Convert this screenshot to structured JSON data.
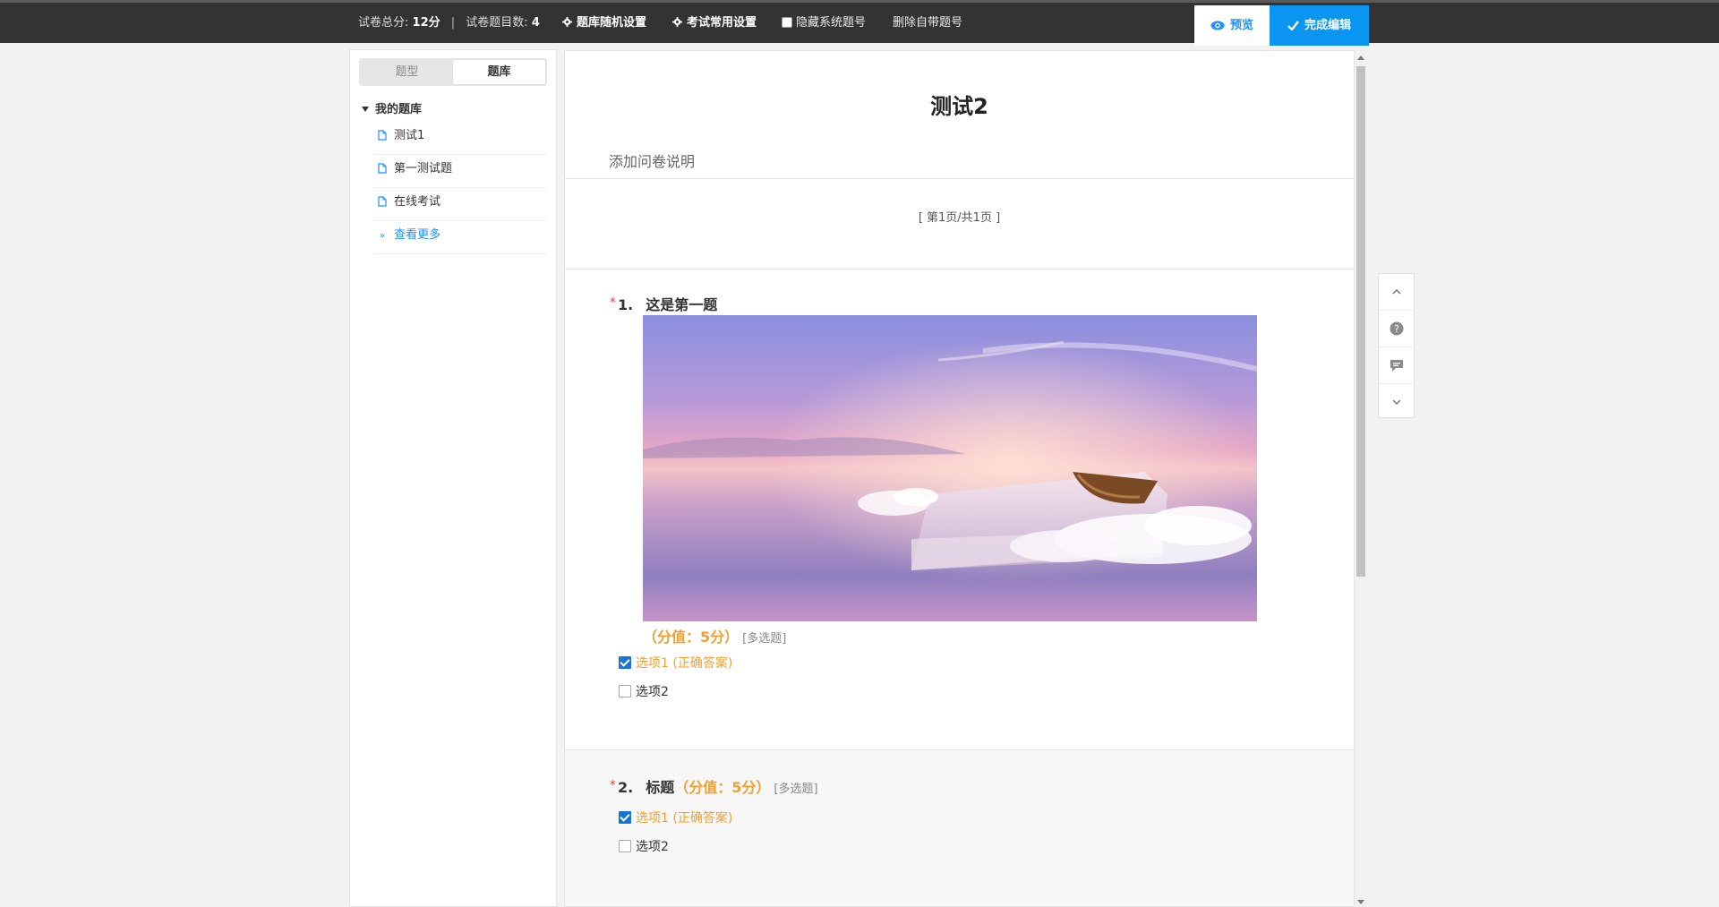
{
  "topbar": {
    "total_label": "试卷总分:",
    "total_value": "12分",
    "separator": "|",
    "count_label": "试卷题目数:",
    "count_value": "4",
    "random_setting": "题库随机设置",
    "common_setting": "考试常用设置",
    "hide_system_numbers": "隐藏系统题号",
    "delete_own_numbers": "删除自带题号",
    "preview": "预览",
    "finish_edit": "完成编辑",
    "accent_color": "#0a96f0"
  },
  "sidebar": {
    "tabs": [
      {
        "label": "题型",
        "active": false
      },
      {
        "label": "题库",
        "active": true
      }
    ],
    "tree_root": "我的题库",
    "items": [
      {
        "label": "测试1",
        "icon": "document-icon"
      },
      {
        "label": "第一测试题",
        "icon": "document-icon"
      },
      {
        "label": "在线考试",
        "icon": "document-icon"
      }
    ],
    "more": "查看更多"
  },
  "paper": {
    "title": "测试2",
    "description": "添加问卷说明",
    "page_info": "[ 第1页/共1页 ]",
    "questions": [
      {
        "required": "*",
        "number": "1.",
        "title": "这是第一题",
        "score": "（分值：5分）",
        "type": "[多选题]",
        "image": "sunset-sea-boat-clouds",
        "options": [
          {
            "label": "选项1 (正确答案)",
            "checked": true
          },
          {
            "label": "选项2",
            "checked": false
          }
        ]
      },
      {
        "required": "*",
        "number": "2.",
        "title": "标题",
        "score": "（分值：5分）",
        "type": "[多选题]",
        "options": [
          {
            "label": "选项1 (正确答案)",
            "checked": true
          },
          {
            "label": "选项2",
            "checked": false
          }
        ]
      }
    ]
  },
  "right_tools": [
    "chevron-up-icon",
    "help-icon",
    "comment-icon",
    "chevron-down-icon"
  ]
}
